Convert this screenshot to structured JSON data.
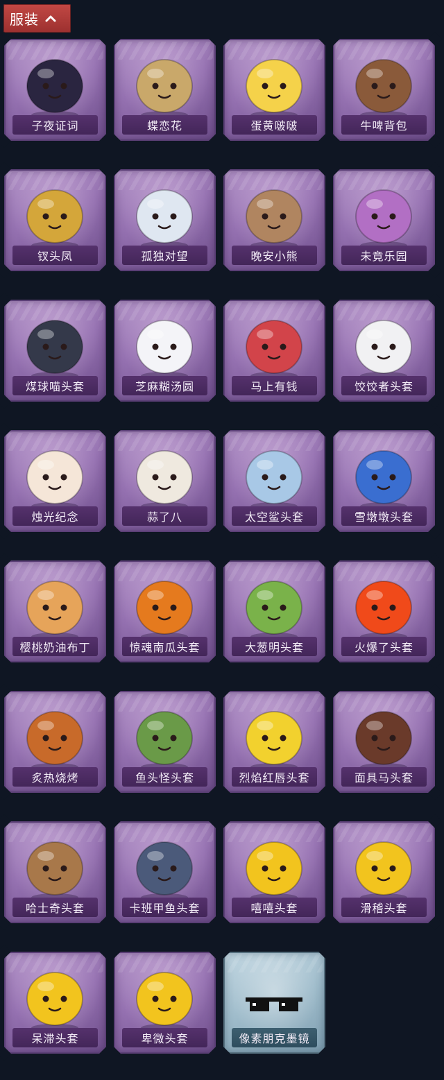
{
  "category_tab": {
    "label": "服装",
    "icon": "chevron-up-icon"
  },
  "items": [
    {
      "name": "子夜证词",
      "icon": "owl-costume-icon",
      "accent": "#2a2540"
    },
    {
      "name": "蝶恋花",
      "icon": "bell-ornament-icon",
      "accent": "#c9a86a"
    },
    {
      "name": "蛋黄啵啵",
      "icon": "egg-chick-icon",
      "accent": "#f5d24a"
    },
    {
      "name": "牛啤背包",
      "icon": "beer-barrel-cow-icon",
      "accent": "#8a5a3a"
    },
    {
      "name": "钗头凤",
      "icon": "phoenix-crown-doll-icon",
      "accent": "#d4a63a"
    },
    {
      "name": "孤独对望",
      "icon": "white-hair-doll-icon",
      "accent": "#dfe7f1"
    },
    {
      "name": "晚安小熊",
      "icon": "teddy-bear-icon",
      "accent": "#b08560"
    },
    {
      "name": "未竟乐园",
      "icon": "purple-hair-doll-icon",
      "accent": "#b26fc4"
    },
    {
      "name": "煤球喵头套",
      "icon": "black-cat-head-icon",
      "accent": "#34394a"
    },
    {
      "name": "芝麻糊汤圆",
      "icon": "rice-ball-head-icon",
      "accent": "#f4f4f8"
    },
    {
      "name": "马上有钱",
      "icon": "red-horse-head-icon",
      "accent": "#d2444a"
    },
    {
      "name": "饺饺者头套",
      "icon": "cloud-dumpling-head-icon",
      "accent": "#f1f1f3"
    },
    {
      "name": "烛光纪念",
      "icon": "candle-head-icon",
      "accent": "#f5e6d8"
    },
    {
      "name": "蒜了八",
      "icon": "garlic-head-icon",
      "accent": "#efe9df"
    },
    {
      "name": "太空鲨头套",
      "icon": "shark-head-icon",
      "accent": "#a8c8e6"
    },
    {
      "name": "雪墩墩头套",
      "icon": "snowman-head-icon",
      "accent": "#3a6ed0"
    },
    {
      "name": "樱桃奶油布丁",
      "icon": "pudding-head-icon",
      "accent": "#e6a45a"
    },
    {
      "name": "惊魂南瓜头套",
      "icon": "pumpkin-head-icon",
      "accent": "#e57a1e"
    },
    {
      "name": "大葱明头套",
      "icon": "scallion-head-icon",
      "accent": "#7ab24a"
    },
    {
      "name": "火爆了头套",
      "icon": "fire-head-icon",
      "accent": "#f04a1a"
    },
    {
      "name": "炙热烧烤",
      "icon": "bbq-meat-head-icon",
      "accent": "#c86a2a"
    },
    {
      "name": "鱼头怪头套",
      "icon": "fish-mask-icon",
      "accent": "#6a9a48"
    },
    {
      "name": "烈焰红唇头套",
      "icon": "yellow-mouse-sunglasses-icon",
      "accent": "#f2d12e"
    },
    {
      "name": "面具马头套",
      "icon": "horse-mask-icon",
      "accent": "#6a3a2a"
    },
    {
      "name": "哈士奇头套",
      "icon": "husky-sunglasses-icon",
      "accent": "#a8784a"
    },
    {
      "name": "卡班甲鱼头套",
      "icon": "whale-head-icon",
      "accent": "#4b5a7a"
    },
    {
      "name": "嘻嘻头套",
      "icon": "grin-emoji-head-icon",
      "accent": "#f2c41e"
    },
    {
      "name": "滑稽头套",
      "icon": "smirk-emoji-head-icon",
      "accent": "#f2c41e"
    },
    {
      "name": "呆滞头套",
      "icon": "flushed-emoji-head-icon",
      "accent": "#f2c41e"
    },
    {
      "name": "卑微头套",
      "icon": "pleading-emoji-head-icon",
      "accent": "#f2c41e"
    },
    {
      "name": "像素朋克墨镜",
      "icon": "pixel-sunglasses-icon",
      "accent": "#111111",
      "special": true
    }
  ]
}
